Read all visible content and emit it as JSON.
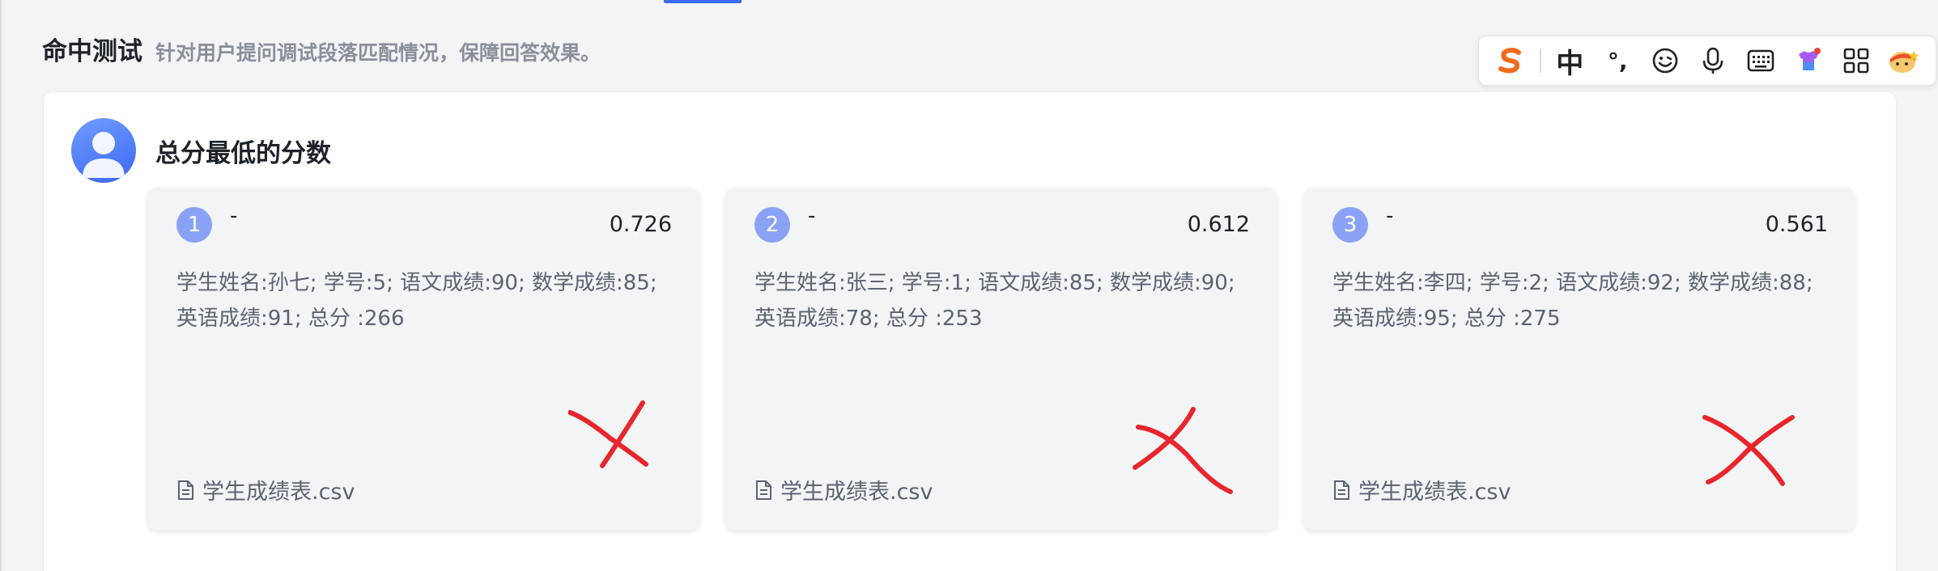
{
  "header": {
    "title": "命中测试",
    "subtitle": "针对用户提问调试段落匹配情况，保障回答效果。"
  },
  "ime": {
    "mode_label": "中",
    "punct_label": "°,",
    "items": [
      "sogou-logo-icon",
      "chinese-mode",
      "punctuation-icon",
      "emoji-icon",
      "microphone-icon",
      "keyboard-icon",
      "skin-icon",
      "toolbox-grid-icon",
      "mascot-icon"
    ]
  },
  "query": {
    "text": "总分最低的分数"
  },
  "results": [
    {
      "rank": "1",
      "title": "-",
      "score": "0.726",
      "content": "学生姓名:孙七; 学号:5; 语文成绩:90; 数学成绩:85; 英语成绩:91; 总分 :266",
      "file": "学生成绩表.csv"
    },
    {
      "rank": "2",
      "title": "-",
      "score": "0.612",
      "content": "学生姓名:张三; 学号:1; 语文成绩:85; 数学成绩:90; 英语成绩:78; 总分 :253",
      "file": "学生成绩表.csv"
    },
    {
      "rank": "3",
      "title": "-",
      "score": "0.561",
      "content": "学生姓名:李四; 学号:2; 语文成绩:92; 数学成绩:88; 英语成绩:95; 总分 :275",
      "file": "学生成绩表.csv"
    }
  ],
  "colors": {
    "accent": "#3b6cf6",
    "rank_badge": "#8aa2f6",
    "annotation_mark": "#e8262c"
  }
}
